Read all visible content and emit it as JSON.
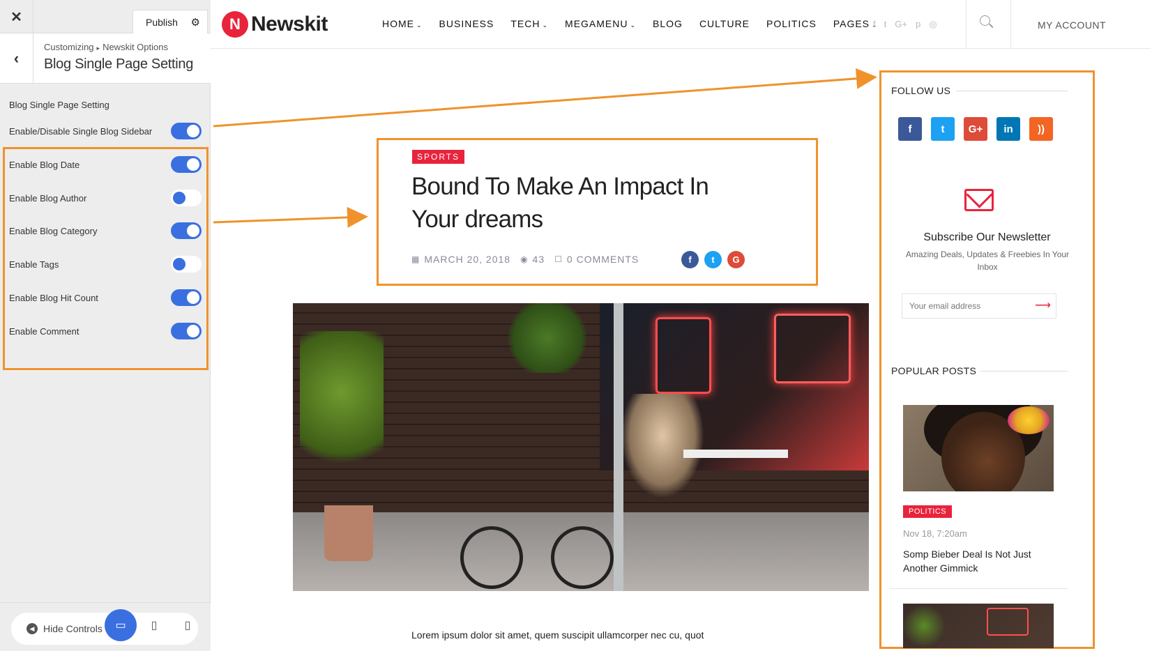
{
  "customizer": {
    "publish_label": "Publish",
    "breadcrumb_root": "Customizing",
    "breadcrumb_section": "Newskit Options",
    "section_title": "Blog Single Page Setting",
    "group_label": "Blog Single Page Setting",
    "settings": [
      {
        "label": "Enable/Disable Single Blog Sidebar",
        "on": true
      },
      {
        "label": "Enable Blog Date",
        "on": true
      },
      {
        "label": "Enable Blog Author",
        "on": false
      },
      {
        "label": "Enable Blog Category",
        "on": true
      },
      {
        "label": "Enable Tags",
        "on": false
      },
      {
        "label": "Enable Blog Hit Count",
        "on": true
      },
      {
        "label": "Enable Comment",
        "on": true
      }
    ],
    "hide_controls_label": "Hide Controls",
    "devices": [
      "desktop-icon",
      "tablet-icon",
      "mobile-icon"
    ],
    "active_device": "desktop"
  },
  "site": {
    "logo_text": "Newskit",
    "logo_mark": "N",
    "nav": [
      {
        "label": "HOME",
        "dropdown": true
      },
      {
        "label": "BUSINESS",
        "dropdown": false
      },
      {
        "label": "TECH",
        "dropdown": true
      },
      {
        "label": "MEGAMENU",
        "dropdown": true
      },
      {
        "label": "BLOG",
        "dropdown": false
      },
      {
        "label": "CULTURE",
        "dropdown": false
      },
      {
        "label": "POLITICS",
        "dropdown": false
      },
      {
        "label": "PAGES",
        "dropdown": true
      }
    ],
    "my_account": "MY ACCOUNT"
  },
  "article": {
    "category": "SPORTS",
    "title": "Bound To Make An Impact In Your dreams",
    "date": "MARCH 20, 2018",
    "views": "43",
    "comments": "0 COMMENTS",
    "body_excerpt": "Lorem ipsum dolor sit amet, quem suscipit ullamcorper nec cu, quot"
  },
  "sidebar": {
    "follow_title": "FOLLOW US",
    "newsletter_title": "Subscribe Our Newsletter",
    "newsletter_sub": "Amazing Deals, Updates & Freebies In Your Inbox",
    "email_placeholder": "Your email address",
    "popular_title": "POPULAR POSTS",
    "popular_posts": [
      {
        "category": "POLITICS",
        "date": "Nov 18, 7:20am",
        "title": "Somp Bieber Deal Is Not Just Another Gimmick"
      }
    ]
  },
  "colors": {
    "accent_red": "#e8233c",
    "toggle_blue": "#3a6fe0",
    "highlight_orange": "#f0922b"
  }
}
